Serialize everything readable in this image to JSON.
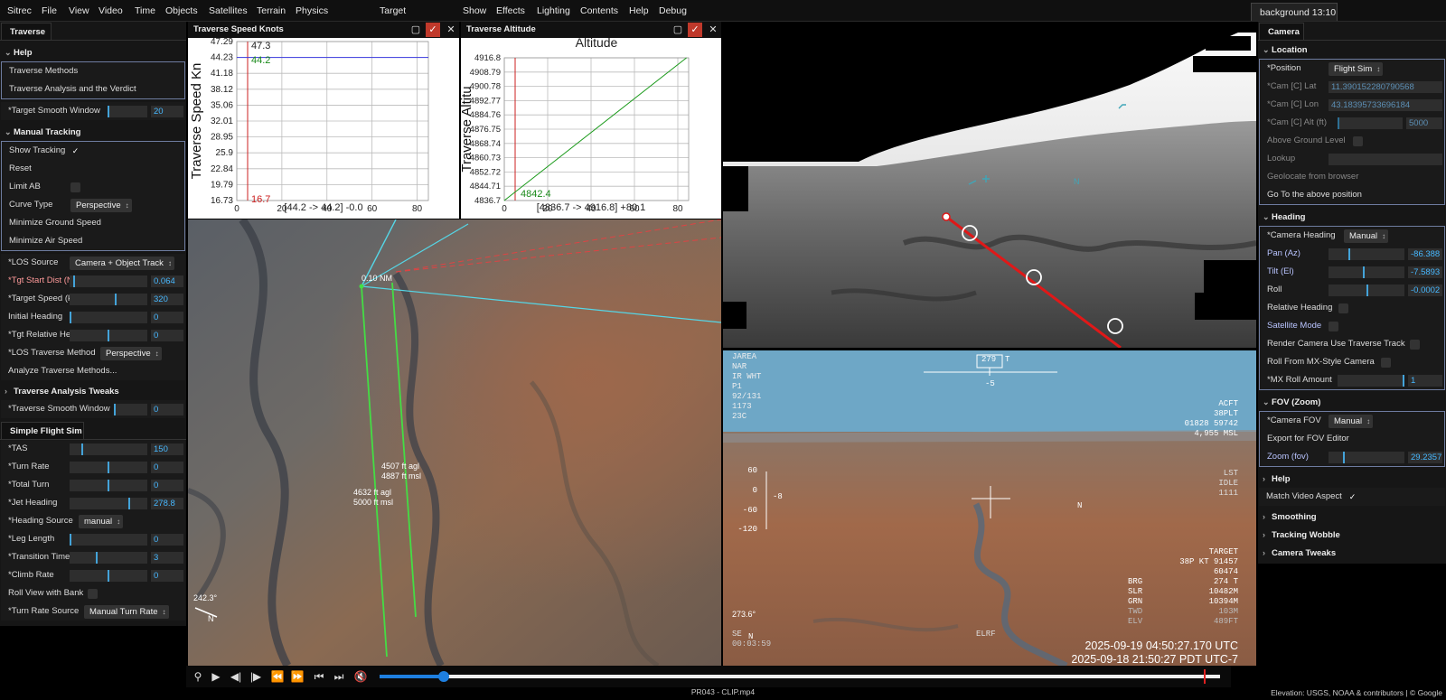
{
  "menubar": {
    "items": [
      "Sitrec",
      "File",
      "View",
      "Video",
      "Time",
      "Objects",
      "Satellites",
      "Terrain",
      "Physics"
    ],
    "target": "Target",
    "items2": [
      "Show",
      "Effects",
      "Lighting",
      "Contents",
      "Help",
      "Debug"
    ],
    "background_tab": "background 13:10"
  },
  "left": {
    "tab": "Traverse",
    "help": {
      "title": "Help",
      "items": [
        "Traverse Methods",
        "Traverse Analysis and the Verdict"
      ]
    },
    "target_smooth": {
      "label": "*Target Smooth Window",
      "value": "20"
    },
    "manual": {
      "title": "Manual Tracking",
      "show_tracking": "Show Tracking",
      "check": "✓",
      "reset": "Reset",
      "limit_ab": "Limit AB",
      "curve_type": "Curve Type",
      "curve_type_value": "Perspective",
      "min_ground": "Minimize Ground Speed",
      "min_air": "Minimize Air Speed"
    },
    "params": [
      {
        "label": "*LOS Source",
        "select": "Camera + Object Track"
      },
      {
        "label": "*Tgt Start Dist (NM)",
        "value": "0.064",
        "knob": 0.05
      },
      {
        "label": "*Target Speed (kt)",
        "value": "320",
        "knob": 0.6
      },
      {
        "label": "Initial Heading",
        "value": "0",
        "knob": 0.0
      },
      {
        "label": "*Tgt Relative Heading",
        "value": "0",
        "knob": 0.5
      },
      {
        "label": "*LOS Traverse Method",
        "select": "Perspective"
      },
      {
        "label": "Analyze Traverse Methods..."
      }
    ],
    "tweaks": "Traverse Analysis Tweaks",
    "traverse_smooth": {
      "label": "*Traverse Smooth Window",
      "value": "0"
    }
  },
  "flightsim": {
    "tab": "Simple Flight Sim",
    "params": [
      {
        "label": "*TAS",
        "value": "150",
        "knob": 0.15
      },
      {
        "label": "*Turn Rate",
        "value": "0",
        "knob": 0.5
      },
      {
        "label": "*Total Turn",
        "value": "0",
        "knob": 0.5
      },
      {
        "label": "*Jet Heading",
        "value": "278.8",
        "knob": 0.77
      },
      {
        "label": "*Heading Source",
        "select": "manual"
      },
      {
        "label": "*Leg Length",
        "value": "0",
        "knob": 0.0
      },
      {
        "label": "*Transition Time",
        "value": "3",
        "knob": 0.35
      },
      {
        "label": "*Climb Rate",
        "value": "0",
        "knob": 0.5
      },
      {
        "label": "Roll View with Bank",
        "check": true
      },
      {
        "label": "*Turn Rate Source",
        "select": "Manual Turn Rate"
      }
    ]
  },
  "speed_chart": {
    "title": "Traverse Speed Knots",
    "ylabel": "Traverse Speed Kn",
    "yticks": [
      "47.29",
      "44.23",
      "41.18",
      "38.12",
      "35.06",
      "32.01",
      "28.95",
      "25.9",
      "22.84",
      "19.79",
      "16.73"
    ],
    "xticks": [
      "0",
      "20",
      "40",
      "60",
      "80"
    ],
    "top_label": "47.3",
    "value_label": "44.2",
    "bottom_label": "16.7",
    "footer": "[44.2 -> 44.2] -0.0",
    "chart_data": {
      "type": "line",
      "xlim": [
        0,
        85
      ],
      "ylim": [
        16.73,
        47.29
      ],
      "series": [
        {
          "x": [
            0,
            85
          ],
          "y": [
            44.23,
            44.23
          ]
        }
      ]
    }
  },
  "alt_chart": {
    "title": "Traverse Altitude",
    "header": "Altitude",
    "ylabel": "Traverse Altitu",
    "yticks": [
      "4916.8",
      "4908.79",
      "4900.78",
      "4892.77",
      "4884.76",
      "4876.75",
      "4868.74",
      "4860.73",
      "4852.72",
      "4844.71",
      "4836.7"
    ],
    "xticks": [
      "0",
      "20",
      "40",
      "60",
      "80"
    ],
    "value_label": "4842.4",
    "footer": "[4836.7 -> 4916.8] +80.1",
    "chart_data": {
      "type": "line",
      "xlim": [
        0,
        85
      ],
      "ylim": [
        4836.7,
        4916.8
      ],
      "series": [
        {
          "x": [
            0,
            84
          ],
          "y": [
            4836.7,
            4916.8
          ]
        }
      ]
    }
  },
  "mainview": {
    "dist_label": "0.10 NM",
    "alt1a": "4507 ft agl",
    "alt1b": "4887 ft msl",
    "alt2a": "4632 ft agl",
    "alt2b": "5000 ft msl",
    "heading": "242.3°",
    "north": "N"
  },
  "irview": {
    "north": "N"
  },
  "hud": {
    "topleft": [
      "JAREA",
      "NAR",
      "IR WHT",
      "P1",
      "92/131",
      "1173",
      "23C"
    ],
    "heading": "279",
    "heading_suffix": "T",
    "heading_sub": "-5",
    "topright": [
      "ACFT",
      "38PLT",
      "01828 59742",
      "4,955 MSL"
    ],
    "right_mid": [
      "LST",
      "IDLE",
      "1111"
    ],
    "pitch": [
      "60",
      "0",
      "-60",
      "-120"
    ],
    "pitch_side": "-8",
    "north": "N",
    "target": [
      "TARGET",
      "38P KT 91457",
      "60474"
    ],
    "target_rows": [
      [
        "BRG",
        "274 T"
      ],
      [
        "SLR",
        "10482M"
      ],
      [
        "GRN",
        "10394M"
      ],
      [
        "TWD",
        "103M"
      ],
      [
        "ELV",
        "489FT"
      ]
    ],
    "elrf": "ELRF",
    "heading2": "273.6°",
    "north2": "N",
    "se": "SE",
    "time_small": "00:03:59",
    "utc": "2025-09-19 04:50:27.170 UTC",
    "pdt": "2025-09-18 21:50:27 PDT UTC-7"
  },
  "camera": {
    "tab": "Camera",
    "location": {
      "title": "Location",
      "position": "*Position",
      "position_value": "Flight Sim",
      "lat": "*Cam [C] Lat",
      "lat_value": "11.390152280790568",
      "lon": "*Cam [C] Lon",
      "lon_value": "43.18395733696184",
      "alt": "*Cam [C] Alt (ft)",
      "alt_value": "5000",
      "agl": "Above Ground Level",
      "lookup": "Lookup",
      "geo": "Geolocate from browser",
      "goto": "Go To the above position"
    },
    "heading": {
      "title": "Heading",
      "cam_heading": "*Camera Heading",
      "cam_heading_value": "Manual",
      "pan": "Pan (Az)",
      "pan_value": "-86.388",
      "tilt": "Tilt (El)",
      "tilt_value": "-7.5893",
      "roll": "Roll",
      "roll_value": "-0.0002",
      "rel": "Relative Heading",
      "sat": "Satellite Mode",
      "render": "Render Camera Use Traverse Track",
      "mxroll": "Roll From MX-Style Camera",
      "mxamt": "*MX Roll Amount",
      "mxamt_value": "1"
    },
    "fov": {
      "title": "FOV (Zoom)",
      "cam_fov": "*Camera FOV",
      "cam_fov_value": "Manual",
      "export": "Export for FOV Editor",
      "zoom": "Zoom (fov)",
      "zoom_value": "29.2357"
    },
    "help": "Help",
    "match": "Match Video Aspect",
    "match_check": "✓",
    "smoothing": "Smoothing",
    "wobble": "Tracking Wobble",
    "tweaks": "Camera Tweaks"
  },
  "bottom": {
    "filename": "PR043 - CLIP.mp4",
    "attribution": "Elevation: USGS, NOAA & contributors | © Google"
  },
  "colors": {
    "accent": "#43a3d9",
    "value": "#47b8ff",
    "green": "#22cc22",
    "red": "#e02020"
  }
}
